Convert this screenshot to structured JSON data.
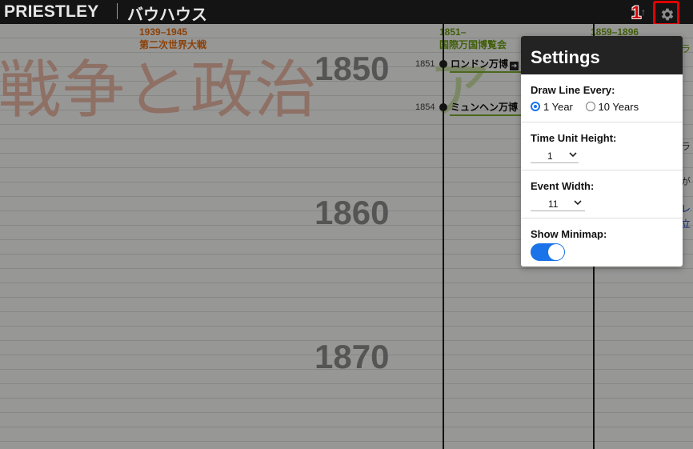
{
  "app": {
    "brand": "PRIESTLEY",
    "subtitle": "バウハウス"
  },
  "annotation": {
    "step": "1"
  },
  "timeline": {
    "watermarks": [
      "戦争と政治",
      "ア"
    ],
    "decades": [
      "1850",
      "1860",
      "1870"
    ],
    "eras": [
      {
        "years": "1939–1945",
        "title": "第二次世界大戦"
      },
      {
        "years": "1851–",
        "title": "国際万国博覧会"
      },
      {
        "years": "1859–1896",
        "title": ""
      }
    ],
    "events": [
      {
        "year": "1851",
        "name": "ロンドン万博"
      },
      {
        "year": "1854",
        "name": "ミュンヘン万博"
      }
    ],
    "peeks": [
      "ラ",
      "ラ",
      "が",
      "レ",
      "立"
    ]
  },
  "settings": {
    "title": "Settings",
    "draw_line_label": "Draw Line Every:",
    "draw_line_options": [
      "1 Year",
      "10 Years"
    ],
    "draw_line_selected": "1 Year",
    "time_unit_label": "Time Unit Height:",
    "time_unit_value": "1",
    "event_width_label": "Event Width:",
    "event_width_value": "11",
    "minimap_label": "Show Minimap:",
    "minimap_on": true
  },
  "colors": {
    "accent": "#1a73e8",
    "highlight": "#e00000",
    "topbar": "#141414"
  }
}
